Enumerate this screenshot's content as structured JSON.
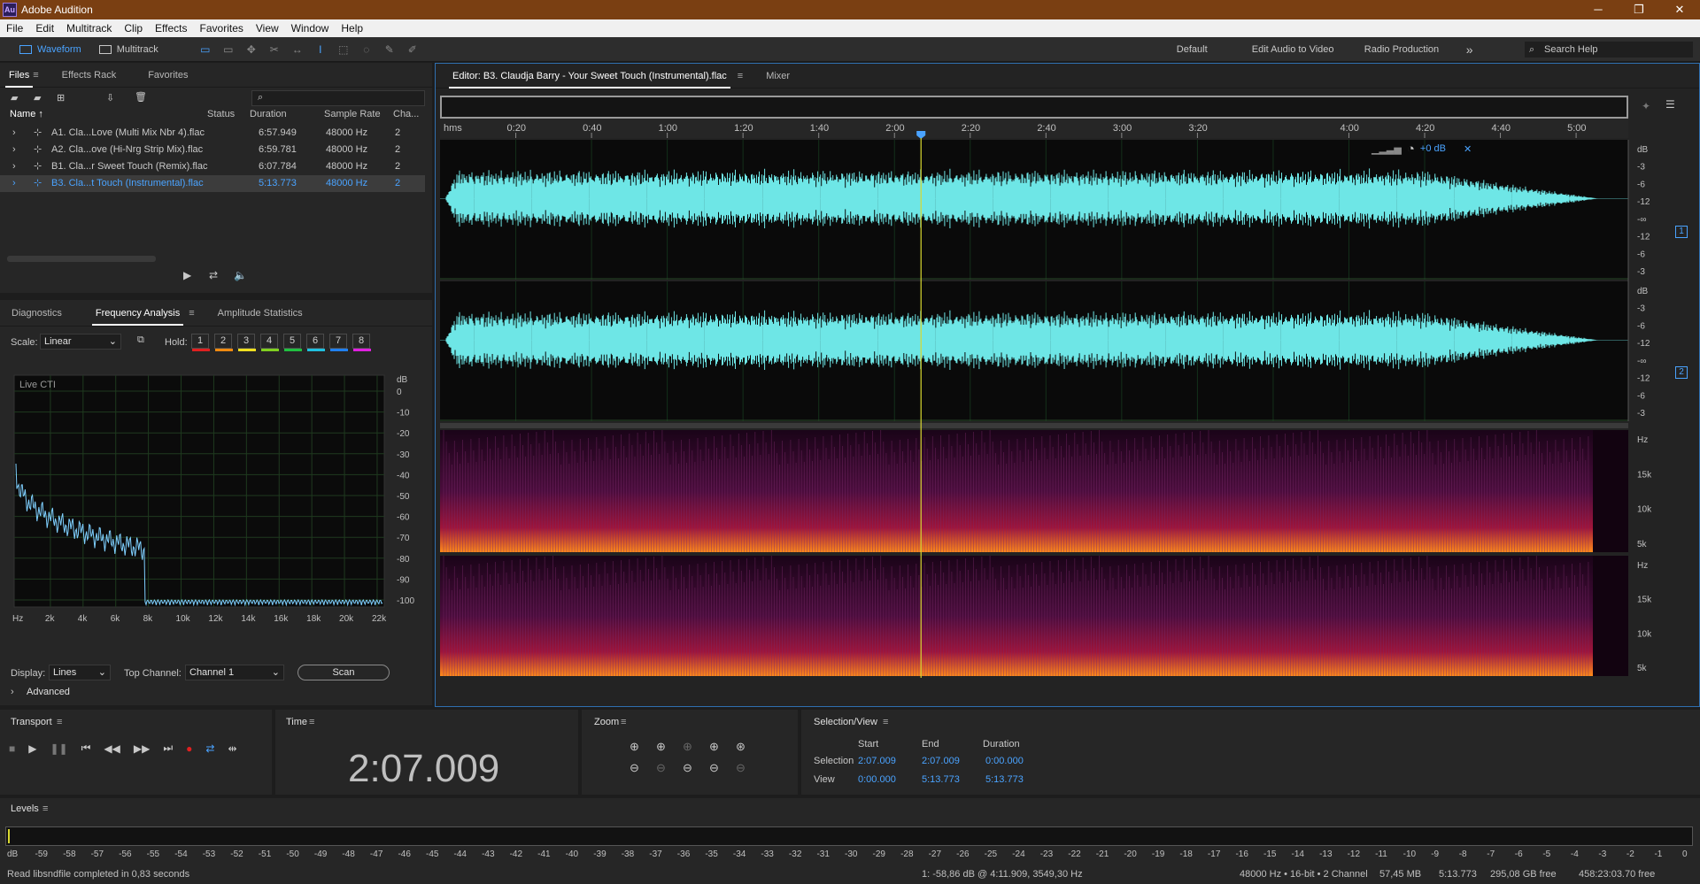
{
  "app": {
    "title": "Adobe Audition",
    "logo": "Au"
  },
  "menu": [
    "File",
    "Edit",
    "Multitrack",
    "Clip",
    "Effects",
    "Favorites",
    "View",
    "Window",
    "Help"
  ],
  "toolbar": {
    "waveform": "Waveform",
    "multitrack": "Multitrack",
    "workspaces": [
      "Default",
      "Edit Audio to Video",
      "Radio Production"
    ],
    "more": "»",
    "search_placeholder": "Search Help"
  },
  "files_panel": {
    "tabs": [
      "Files",
      "Effects Rack",
      "Favorites"
    ],
    "columns": [
      "Name ↑",
      "Status",
      "Duration",
      "Sample Rate",
      "Cha..."
    ],
    "rows": [
      {
        "name": "A1. Cla...Love (Multi Mix Nbr 4).flac",
        "duration": "6:57.949",
        "rate": "48000 Hz",
        "ch": "2"
      },
      {
        "name": "A2. Cla...ove (Hi-Nrg Strip Mix).flac",
        "duration": "6:59.781",
        "rate": "48000 Hz",
        "ch": "2"
      },
      {
        "name": "B1. Cla...r Sweet Touch (Remix).flac",
        "duration": "6:07.784",
        "rate": "48000 Hz",
        "ch": "2"
      },
      {
        "name": "B3. Cla...t Touch (Instrumental).flac",
        "duration": "5:13.773",
        "rate": "48000 Hz",
        "ch": "2"
      }
    ]
  },
  "analysis_panel": {
    "tabs": [
      "Diagnostics",
      "Frequency Analysis",
      "Amplitude Statistics"
    ],
    "scale_label": "Scale:",
    "scale_value": "Linear",
    "hold_label": "Hold:",
    "hold": [
      "1",
      "2",
      "3",
      "4",
      "5",
      "6",
      "7",
      "8"
    ],
    "hold_colors": [
      "#e02020",
      "#f08a10",
      "#f0e020",
      "#80d020",
      "#20c040",
      "#20c0e0",
      "#2080f0",
      "#e020e0"
    ],
    "live_cti": "Live CTI",
    "db_label": "dB",
    "db_ticks": [
      "0",
      "-10",
      "-20",
      "-30",
      "-40",
      "-50",
      "-60",
      "-70",
      "-80",
      "-90",
      "-100"
    ],
    "hz_ticks": [
      "Hz",
      "2k",
      "4k",
      "6k",
      "8k",
      "10k",
      "12k",
      "14k",
      "16k",
      "18k",
      "20k",
      "22k"
    ],
    "display_label": "Display:",
    "display_value": "Lines",
    "top_channel_label": "Top Channel:",
    "top_channel_value": "Channel 1",
    "scan": "Scan",
    "advanced": "Advanced"
  },
  "editor": {
    "tab": "Editor: B3. Claudja Barry - Your Sweet Touch (Instrumental).flac",
    "mixer": "Mixer",
    "time_units": "hms",
    "ruler": [
      "0:20",
      "0:40",
      "1:00",
      "1:20",
      "1:40",
      "2:00",
      "2:20",
      "2:40",
      "3:00",
      "3:20",
      "4:00",
      "4:20",
      "4:40",
      "5:00"
    ],
    "volume": "+0 dB",
    "ch1_badge": "1",
    "ch2_badge": "2",
    "db_scale_top": [
      "dB",
      "-3",
      "-6",
      "-12",
      "-∞",
      "-12",
      "-6",
      "-3"
    ],
    "db_scale_bot": [
      "dB",
      "-3",
      "-6",
      "-12",
      "-∞",
      "-12",
      "-6",
      "-3"
    ],
    "hz_scale_top": [
      "Hz",
      "15k",
      "10k",
      "5k"
    ],
    "hz_scale_bot": [
      "Hz",
      "15k",
      "10k",
      "5k"
    ],
    "colors": {
      "wave": "#6ee6e6",
      "playhead": "#d8d830",
      "cti_marker": "#4aa3ff"
    }
  },
  "transport": {
    "title": "Transport"
  },
  "time": {
    "title": "Time",
    "value": "2:07.009"
  },
  "zoom": {
    "title": "Zoom"
  },
  "selection": {
    "title": "Selection/View",
    "headers": [
      "Start",
      "End",
      "Duration"
    ],
    "selection_label": "Selection",
    "view_label": "View",
    "selection_values": [
      "2:07.009",
      "2:07.009",
      "0:00.000"
    ],
    "view_values": [
      "0:00.000",
      "5:13.773",
      "5:13.773"
    ]
  },
  "levels": {
    "title": "Levels",
    "ticks": [
      "dB",
      "-59",
      "-58",
      "-57",
      "-56",
      "-55",
      "-54",
      "-53",
      "-52",
      "-51",
      "-50",
      "-49",
      "-48",
      "-47",
      "-46",
      "-45",
      "-44",
      "-43",
      "-42",
      "-41",
      "-40",
      "-39",
      "-38",
      "-37",
      "-36",
      "-35",
      "-34",
      "-33",
      "-32",
      "-31",
      "-30",
      "-29",
      "-28",
      "-27",
      "-26",
      "-25",
      "-24",
      "-23",
      "-22",
      "-21",
      "-20",
      "-19",
      "-18",
      "-17",
      "-16",
      "-15",
      "-14",
      "-13",
      "-12",
      "-11",
      "-10",
      "-9",
      "-8",
      "-7",
      "-6",
      "-5",
      "-4",
      "-3",
      "-2",
      "-1",
      "0"
    ]
  },
  "status": {
    "message": "Read libsndfile completed in 0,83 seconds",
    "cursor": "1: -58,86 dB @ 4:11.909, 3549,30 Hz",
    "format": "48000 Hz • 16-bit • 2 Channel",
    "size": "57,45 MB",
    "duration": "5:13.773",
    "free": "295,08 GB free",
    "free_time": "458:23:03.70 free"
  }
}
